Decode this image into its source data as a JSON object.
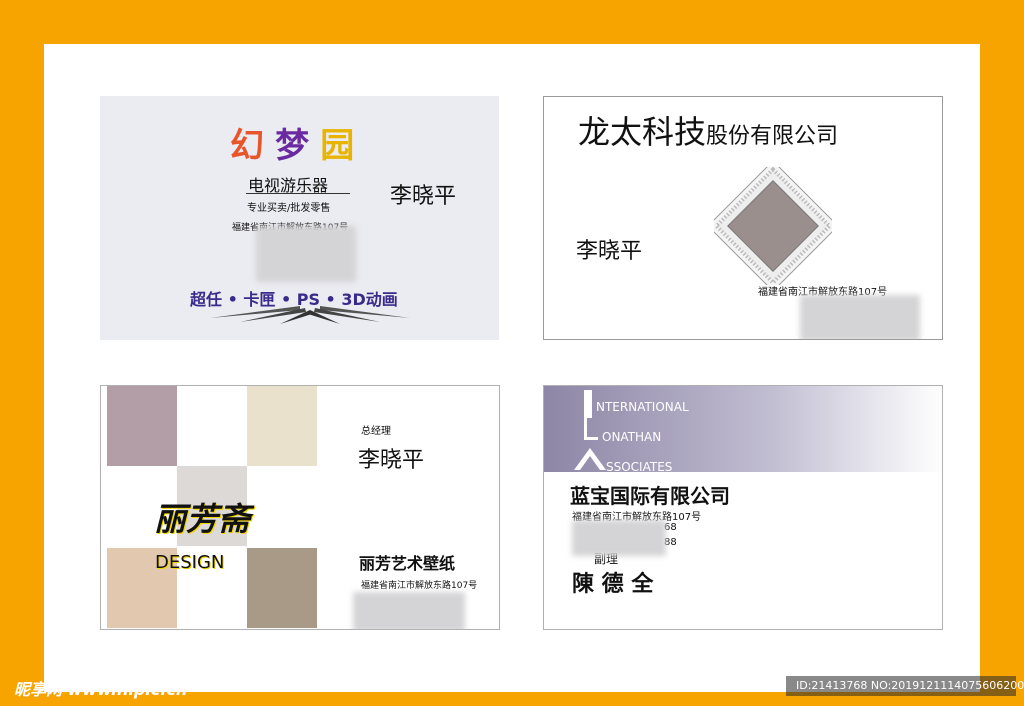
{
  "card1": {
    "logo_chars": [
      "幻",
      "梦",
      "园"
    ],
    "subtitle": "电视游乐器",
    "tagline": "专业买卖/批发零售",
    "address": "福建省南江市解放东路107号",
    "name": "李晓平",
    "products": "超任 • 卡匣 • PS • 3D动画"
  },
  "card2": {
    "company_main": "龙太科技",
    "company_suffix": "股份有限公司",
    "name": "李晓平",
    "address": "福建省南江市解放东路107号"
  },
  "card3": {
    "title": "总经理",
    "name": "李晓平",
    "brand": "丽芳斋",
    "brand_en": "DESIGN",
    "shop": "丽芳艺术壁纸",
    "address": "福建省南江市解放东路107号"
  },
  "card4": {
    "logo_lines": [
      "NTERNATIONAL",
      "ONATHAN",
      "SSOCIATES"
    ],
    "company": "蓝宝国际有限公司",
    "address": "福建省南江市解放东路107号",
    "phone_fragment_1": "68",
    "phone_fragment_2": "88",
    "title_fragment": "副理",
    "name": "陳 德 全"
  },
  "footer": {
    "watermark": "昵享网 www.nipic.cn",
    "id_text": "ID:21413768 NO:20191211140756062000"
  },
  "colors": {
    "border_orange": "#f7a300",
    "product_text": "#3a2a8a",
    "card4_band": "#8d86a6"
  }
}
